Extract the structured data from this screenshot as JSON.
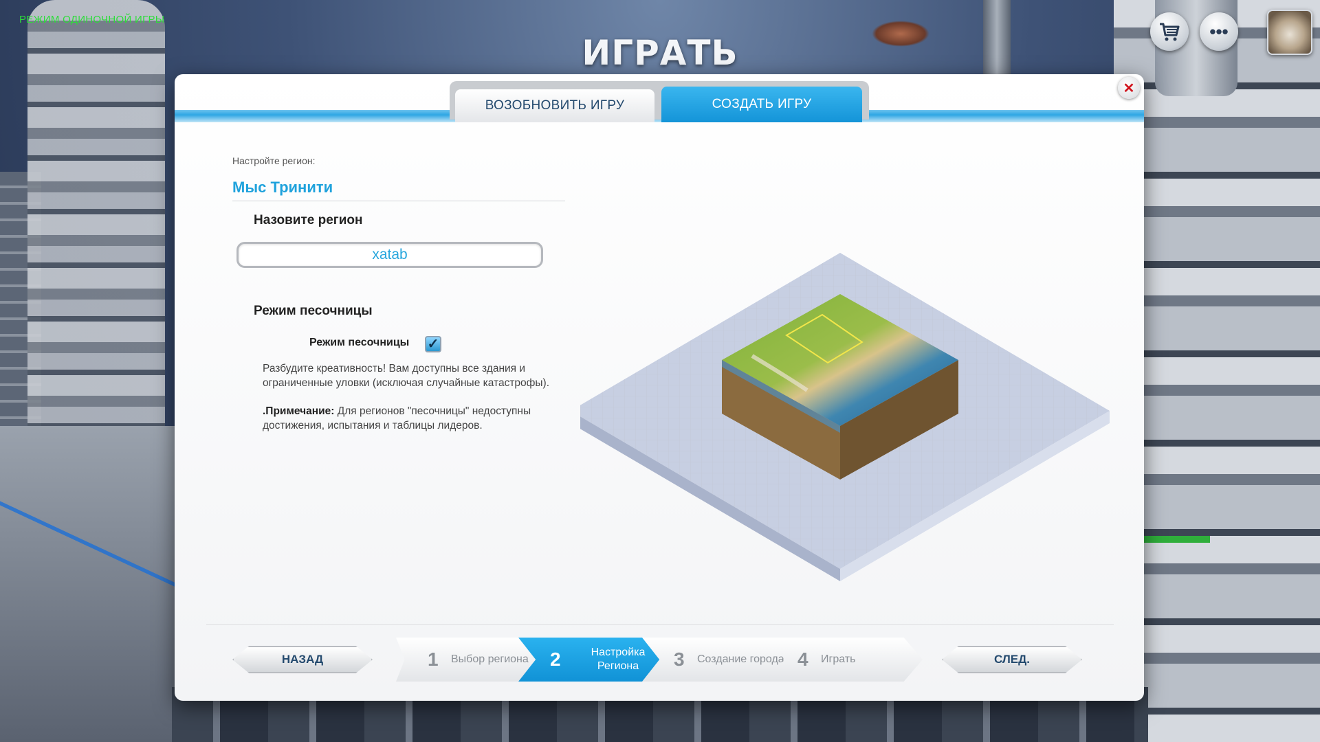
{
  "game_mode_label": "РЕЖИМ ОДИНОЧНОЙ ИГРЫ",
  "page_title": "ИГРАТЬ",
  "hud": {
    "cart_icon": "cart-icon",
    "more_icon": "more-icon",
    "more_glyph": "•••"
  },
  "tabs": [
    {
      "label": "ВОЗОБНОВИТЬ ИГРУ",
      "active": false
    },
    {
      "label": "СОЗДАТЬ ИГРУ",
      "active": true
    }
  ],
  "close_glyph": "✕",
  "region": {
    "configure_label": "Настройте регион:",
    "name": "Мыс Тринити",
    "name_field_label": "Назовите регион",
    "name_value": "xatab"
  },
  "sandbox": {
    "heading": "Режим песочницы",
    "checkbox_label": "Режим песочницы",
    "checked": true,
    "check_glyph": "✓",
    "description": "Разбудите креативность! Вам доступны все здания и ограниченные уловки (исключая случайные катастрофы).",
    "note_prefix": ".Примечание:",
    "note_text": " Для регионов \"песочницы\" недоступны достижения, испытания и таблицы лидеров."
  },
  "footer": {
    "back_label": "НАЗАД",
    "next_label": "СЛЕД.",
    "steps": [
      {
        "num": "1",
        "label": "Выбор региона",
        "active": false
      },
      {
        "num": "2",
        "label": "Настройка Региона",
        "active": true
      },
      {
        "num": "3",
        "label": "Создание города",
        "active": false
      },
      {
        "num": "4",
        "label": "Играть",
        "active": false
      }
    ]
  },
  "colors": {
    "accent": "#1fa2dc",
    "tab_active": "#1494d8",
    "close": "#d0121b",
    "mode_label": "#2ddc3a"
  }
}
